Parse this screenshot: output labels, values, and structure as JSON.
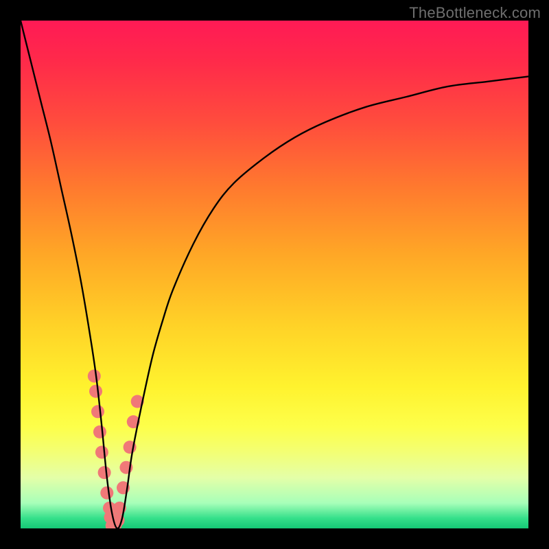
{
  "watermark": "TheBottleneck.com",
  "gradient_colors": {
    "top": "#ff1a55",
    "upper_mid": "#ffa726",
    "lower_mid": "#fff22e",
    "bottom": "#15c876"
  },
  "chart_data": {
    "type": "line",
    "title": "",
    "xlabel": "",
    "ylabel": "",
    "xlim": [
      0,
      100
    ],
    "ylim": [
      0,
      100
    ],
    "grid": false,
    "legend": false,
    "series": [
      {
        "name": "bottleneck-curve",
        "color": "#000000",
        "x": [
          0,
          2,
          4,
          6,
          8,
          10,
          12,
          14,
          15,
          16,
          17,
          18,
          19,
          20,
          21,
          22,
          24,
          26,
          28,
          30,
          34,
          38,
          42,
          48,
          54,
          60,
          68,
          76,
          84,
          92,
          100
        ],
        "y": [
          100,
          92,
          84,
          76,
          67,
          58,
          48,
          36,
          29,
          20,
          10,
          3,
          0,
          2,
          8,
          15,
          25,
          34,
          41,
          47,
          56,
          63,
          68,
          73,
          77,
          80,
          83,
          85,
          87,
          88,
          89
        ]
      }
    ],
    "markers": [
      {
        "name": "left-cluster",
        "color": "#f07878",
        "points": [
          {
            "x": 14.5,
            "y": 30
          },
          {
            "x": 14.8,
            "y": 27
          },
          {
            "x": 15.2,
            "y": 23
          },
          {
            "x": 15.6,
            "y": 19
          },
          {
            "x": 16.0,
            "y": 15
          },
          {
            "x": 16.5,
            "y": 11
          },
          {
            "x": 17.0,
            "y": 7
          },
          {
            "x": 17.5,
            "y": 4
          }
        ]
      },
      {
        "name": "right-cluster",
        "color": "#f07878",
        "points": [
          {
            "x": 19.5,
            "y": 4
          },
          {
            "x": 20.2,
            "y": 8
          },
          {
            "x": 20.8,
            "y": 12
          },
          {
            "x": 21.5,
            "y": 16
          },
          {
            "x": 22.2,
            "y": 21
          },
          {
            "x": 23.0,
            "y": 25
          }
        ]
      },
      {
        "name": "bottom-cluster",
        "color": "#f07878",
        "points": [
          {
            "x": 17.7,
            "y": 2.2
          },
          {
            "x": 18.2,
            "y": 1.0
          },
          {
            "x": 18.7,
            "y": 0.8
          },
          {
            "x": 19.2,
            "y": 1.6
          },
          {
            "x": 18.0,
            "y": 0.5
          }
        ]
      }
    ]
  }
}
